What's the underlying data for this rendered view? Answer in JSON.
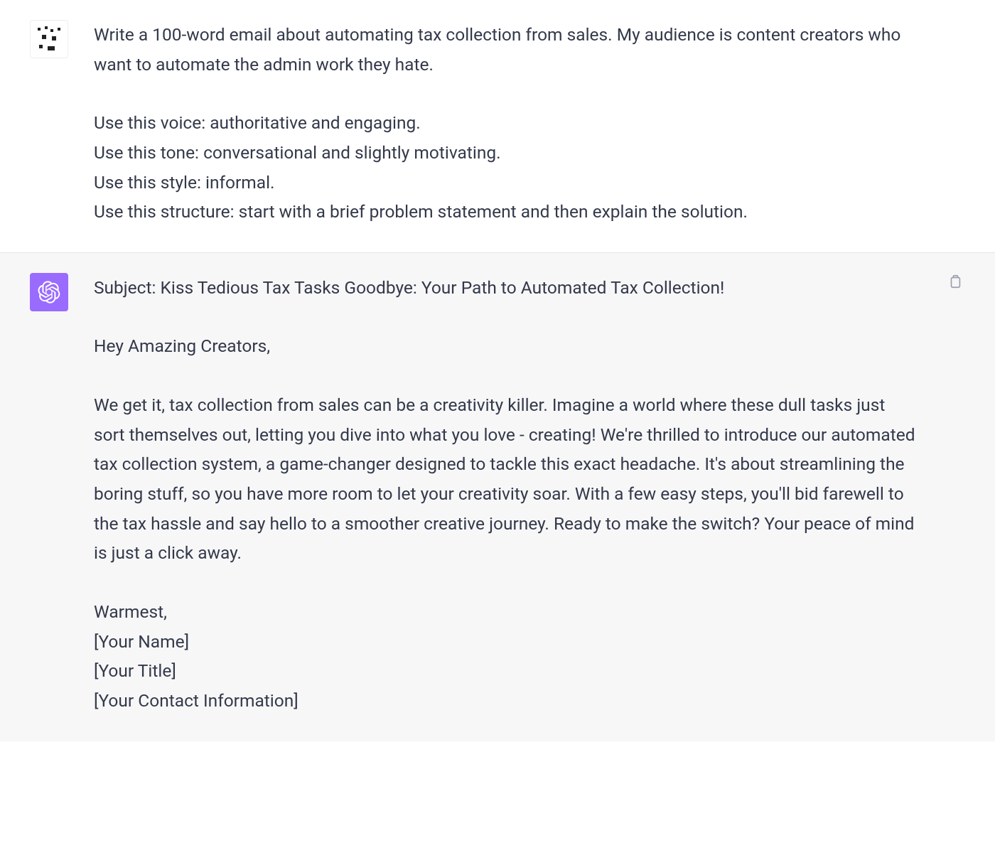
{
  "user_message": {
    "p1": "Write a 100-word email about automating tax collection from sales. My audience is content creators who want to automate the admin work they hate.",
    "voice": "Use this voice: authoritative and engaging.",
    "tone": "Use this tone: conversational and slightly motivating.",
    "style": "Use this style: informal.",
    "structure": "Use this structure: start with a brief problem statement and then explain the solution."
  },
  "assistant_message": {
    "subject": "Subject: Kiss Tedious Tax Tasks Goodbye: Your Path to Automated Tax Collection!",
    "greeting": "Hey Amazing Creators,",
    "body": "We get it, tax collection from sales can be a creativity killer. Imagine a world where these dull tasks just sort themselves out, letting you dive into what you love - creating! We're thrilled to introduce our automated tax collection system, a game-changer designed to tackle this exact headache. It's about streamlining the boring stuff, so you have more room to let your creativity soar. With a few easy steps, you'll bid farewell to the tax hassle and say hello to a smoother creative journey. Ready to make the switch? Your peace of mind is just a click away.",
    "signoff": "Warmest,",
    "sig_name": "[Your Name]",
    "sig_title": "[Your Title]",
    "sig_contact": "[Your Contact Information]"
  },
  "icons": {
    "copy": "copy-icon",
    "assistant_logo": "openai-logo-icon",
    "user_avatar": "user-avatar-icon"
  }
}
